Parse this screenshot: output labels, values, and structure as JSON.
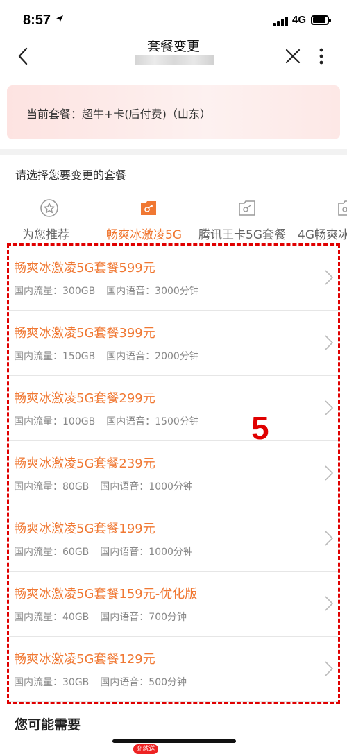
{
  "status_bar": {
    "time": "8:57",
    "network": "4G"
  },
  "nav": {
    "title": "套餐变更"
  },
  "current_plan": {
    "text": "当前套餐：超牛+卡(后付费)（山东）"
  },
  "select_label": "请选择您要变更的套餐",
  "tabs": [
    {
      "label": "为您推荐",
      "icon": "star-icon",
      "active": false
    },
    {
      "label": "畅爽冰激凌5G",
      "icon": "bag-icon",
      "active": true
    },
    {
      "label": "腾讯王卡5G套餐",
      "icon": "bag-outline-icon",
      "active": false
    },
    {
      "label": "4G畅爽冰",
      "icon": "bag-outline-icon",
      "active": false
    }
  ],
  "plans": [
    {
      "name": "畅爽冰激凌5G套餐599元",
      "data": "国内流量：300GB",
      "voice": "国内语音：3000分钟"
    },
    {
      "name": "畅爽冰激凌5G套餐399元",
      "data": "国内流量：150GB",
      "voice": "国内语音：2000分钟"
    },
    {
      "name": "畅爽冰激凌5G套餐299元",
      "data": "国内流量：100GB",
      "voice": "国内语音：1500分钟"
    },
    {
      "name": "畅爽冰激凌5G套餐239元",
      "data": "国内流量：80GB",
      "voice": "国内语音：1000分钟"
    },
    {
      "name": "畅爽冰激凌5G套餐199元",
      "data": "国内流量：60GB",
      "voice": "国内语音：1000分钟"
    },
    {
      "name": "畅爽冰激凌5G套餐159元-优化版",
      "data": "国内流量：40GB",
      "voice": "国内语音：700分钟"
    },
    {
      "name": "畅爽冰激凌5G套餐129元",
      "data": "国内流量：30GB",
      "voice": "国内语音：500分钟"
    }
  ],
  "annotation_number": "5",
  "section_title": "您可能需要",
  "promo_badge": "充就送",
  "colors": {
    "accent": "#f07833",
    "annotation": "#e00000"
  }
}
